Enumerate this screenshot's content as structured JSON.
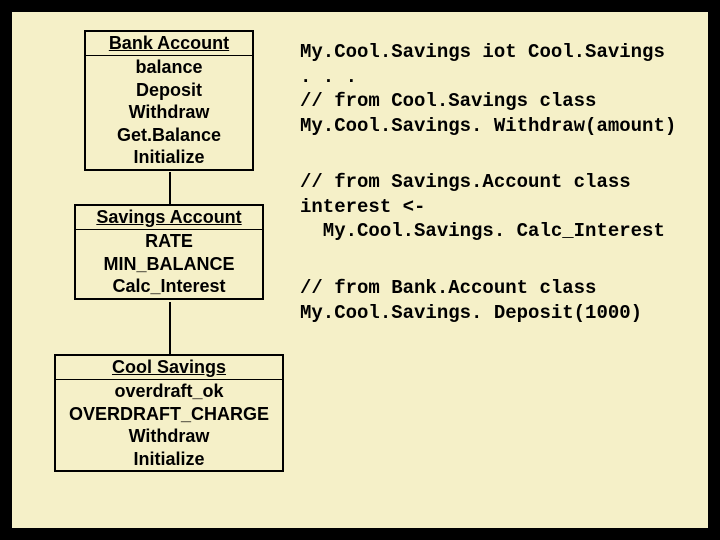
{
  "classes": {
    "bank": {
      "title": "Bank Account",
      "rows": [
        "balance",
        "Deposit",
        "Withdraw",
        "Get.Balance",
        "Initialize"
      ]
    },
    "savings": {
      "title": "Savings Account",
      "rows": [
        "RATE",
        "MIN_BALANCE",
        "Calc_Interest"
      ]
    },
    "cool": {
      "title": "Cool Savings",
      "rows": [
        "overdraft_ok",
        "OVERDRAFT_CHARGE",
        "Withdraw",
        "Initialize"
      ]
    }
  },
  "code": {
    "block1": "My.Cool.Savings iot Cool.Savings\n. . .\n// from Cool.Savings class\nMy.Cool.Savings. Withdraw(amount)",
    "block2": "// from Savings.Account class\ninterest <-\n  My.Cool.Savings. Calc_Interest",
    "block3": "// from Bank.Account class\nMy.Cool.Savings. Deposit(1000)"
  }
}
